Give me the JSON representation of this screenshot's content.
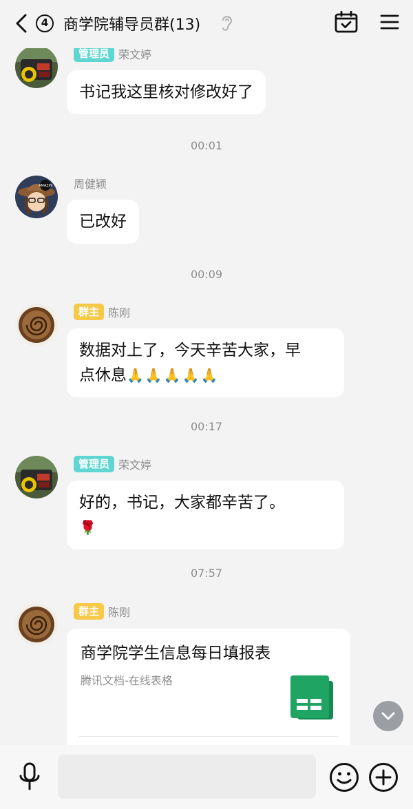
{
  "header": {
    "unread_count": "4",
    "title": "商学院辅导员群(13)"
  },
  "messages": [
    {
      "role": "管理员",
      "sender": "荣文婷",
      "text": "书记我这里核对修改好了"
    },
    {
      "time": "00:01"
    },
    {
      "sender": "周健颖",
      "text": "已改好"
    },
    {
      "time": "00:09"
    },
    {
      "role": "群主",
      "sender": "陈刚",
      "text_line1": "数据对上了，今天辛苦大家，早",
      "text_line2": "点休息",
      "emoji": "🙏🙏🙏🙏🙏"
    },
    {
      "time": "00:17"
    },
    {
      "role": "管理员",
      "sender": "荣文婷",
      "text": "好的，书记，大家都辛苦了。",
      "emoji": "🌹"
    },
    {
      "time": "07:57"
    },
    {
      "role": "群主",
      "sender": "陈刚",
      "card_title": "商学院学生信息每日填报表",
      "card_source": "腾讯文档-在线表格"
    }
  ],
  "input": {
    "placeholder": ""
  },
  "icons": {
    "back": "chevron-left-icon",
    "ear": "ear-icon",
    "calendar": "calendar-check-icon",
    "menu": "hamburger-menu-icon",
    "mic": "microphone-icon",
    "emoji": "smiley-icon",
    "plus": "plus-circle-icon",
    "scroll": "chevron-down-icon",
    "sheet": "spreadsheet-icon"
  },
  "colors": {
    "admin_badge": "#5fd6d2",
    "owner_badge": "#f7c948",
    "sheet_green": "#1fa463",
    "background": "#f3f3f3"
  }
}
